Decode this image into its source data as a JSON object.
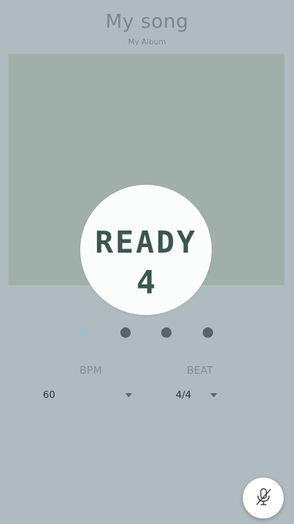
{
  "song": {
    "title": "My song",
    "album": "My Album"
  },
  "overlay": {
    "status": "READY",
    "countdown": "4"
  },
  "beat_dots": {
    "count": 4,
    "active_index": 0
  },
  "bpm": {
    "label": "BPM",
    "value": "60"
  },
  "beat": {
    "label": "BEAT",
    "value": "4/4"
  },
  "mic_button": {
    "icon": "mic-off-icon"
  },
  "colors": {
    "background": "#b0bbbf",
    "art_placeholder": "#a1afab",
    "overlay_text": "#3d5650",
    "dot_active": "#9ec1c9",
    "dot_inactive": "#58636b"
  }
}
